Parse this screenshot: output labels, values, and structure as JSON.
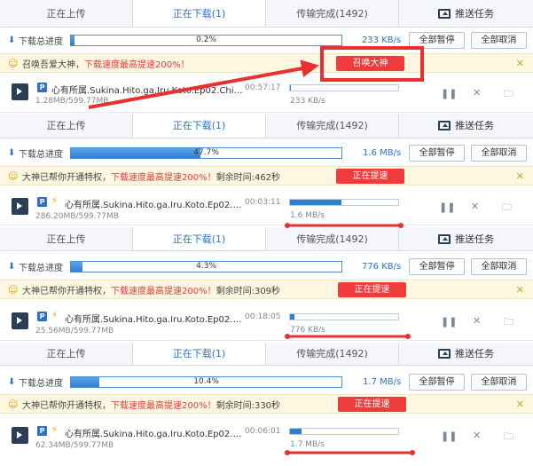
{
  "tabs": {
    "uploading": "正在上传",
    "downloading": "正在下载(1)",
    "completed": "传输完成(1492)",
    "push": "推送任务"
  },
  "summary_label": "下载总进度",
  "buttons": {
    "pause_all": "全部暂停",
    "cancel_all": "全部取消"
  },
  "colors": {
    "accent": "#2f6fc6",
    "alert_red": "#ef3b3b",
    "notice_bg": "#fdf6e0"
  },
  "panels": [
    {
      "summary_progress": 0.2,
      "summary_percent": "0.2%",
      "summary_speed": "233 KB/s",
      "notice_text": "召唤吾爱大神，",
      "notice_red": "下载速度最高提速200%！",
      "notice_tail": "",
      "notice_button": "召唤大神",
      "file_name": "心有所属.Sukina.Hito.ga.Iru.Koto.Ep02.Chi_Jap...",
      "file_eta": "00:57:17",
      "file_size": "1.28MB/599.77MB",
      "file_speed": "233 KB/s",
      "file_progress": 0.002
    },
    {
      "summary_progress": 47.7,
      "summary_percent": "47.7%",
      "summary_speed": "1.6 MB/s",
      "notice_text": "大神已帮你开通特权，",
      "notice_red": "下载速度最高提速200%！",
      "notice_tail": "剩余时间:462秒",
      "notice_button": "正在提速",
      "file_name": "心有所属.Sukina.Hito.ga.Iru.Koto.Ep02.Chi_J...",
      "file_eta": "00:03:11",
      "file_size": "286.20MB/599.77MB",
      "file_speed": "1.6 MB/s",
      "file_progress": 0.477
    },
    {
      "summary_progress": 4.3,
      "summary_percent": "4.3%",
      "summary_speed": "776 KB/s",
      "notice_text": "大神已帮你开通特权，",
      "notice_red": "下载速度最高提速200%！",
      "notice_tail": "剩余时间:309秒",
      "notice_button": "正在提速",
      "file_name": "心有所属.Sukina.Hito.ga.Iru.Koto.Ep02.Chi_J...",
      "file_eta": "00:18:05",
      "file_size": "25.56MB/599.77MB",
      "file_speed": "776 KB/s",
      "file_progress": 0.043
    },
    {
      "summary_progress": 10.4,
      "summary_percent": "10.4%",
      "summary_speed": "1.7 MB/s",
      "notice_text": "大神已帮你开通特权，",
      "notice_red": "下载速度最高提速200%！",
      "notice_tail": "剩余时间:330秒",
      "notice_button": "正在提速",
      "file_name": "心有所属.Sukina.Hito.ga.Iru.Koto.Ep02.Chi_J...",
      "file_eta": "00:06:01",
      "file_size": "62.34MB/599.77MB",
      "file_speed": "1.7 MB/s",
      "file_progress": 0.104
    }
  ]
}
